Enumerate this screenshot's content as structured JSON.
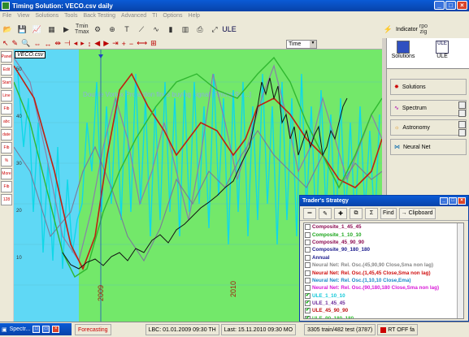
{
  "window": {
    "title": "Timing Solution:  VECO.csv  daily"
  },
  "menu": [
    "File",
    "View",
    "Solutions",
    "Tools",
    "Back Testing",
    "Advanced",
    "TI",
    "Options",
    "Help"
  ],
  "toolbar": {
    "tmin": "Tmin",
    "tmax": "Tmax",
    "zoom_select": "Time",
    "indicator": "Indicator",
    "rpo": "rpo",
    "zig": "zig"
  },
  "top_right": {
    "solutions": "Solutions",
    "ule": "ULE"
  },
  "chart": {
    "file_label": "VECO.csv",
    "watermark": "Double Vortex Projection finds buying signal [Timing Sol...]",
    "year_2009": "2009",
    "year_2010": "2010",
    "y_labels": [
      "50",
      "40",
      "30",
      "20",
      "10"
    ],
    "colors": {
      "bg_left": "#5fd8f5",
      "bg_right": "#73e86a"
    }
  },
  "left_tools": [
    "Panel",
    "Edit",
    "Start",
    "Line",
    "Fib",
    "abc",
    "date",
    "Fib",
    "%",
    "More",
    "Fib",
    "128"
  ],
  "right_panel": {
    "solutions_btn": "Solutions",
    "spectrum_btn": "Spectrum",
    "astronomy_btn": "Astronomy",
    "neural_btn": "Neural Net"
  },
  "strategy": {
    "title": "Trader's Strategy",
    "find": "Find",
    "clipboard": "Clipboard",
    "items": [
      {
        "label": "Composite_1_45_45",
        "color": "#8b0a50",
        "checked": false
      },
      {
        "label": "Composite_1_10_10",
        "color": "#1aa51a",
        "checked": false
      },
      {
        "label": "Composite_45_90_90",
        "color": "#8b0a50",
        "checked": false
      },
      {
        "label": "Composite_90_180_180",
        "color": "#1a1a8c",
        "checked": false
      },
      {
        "label": "Annual",
        "color": "#1a1a8c",
        "checked": false
      },
      {
        "label": "Neural Net: Rel. Osc.(45,90,90 Close,Sma non lag)",
        "color": "#888888",
        "checked": false
      },
      {
        "label": "Neural Net: Rel. Osc.(1,45,45 Close,Sma non lag)",
        "color": "#d01010",
        "checked": false
      },
      {
        "label": "Neural Net: Rel. Osc.(1,10,10 Close,Ema)",
        "color": "#1a8ac8",
        "checked": false
      },
      {
        "label": "Neural Net: Rel. Osc.(90,180,180 Close,Sma non lag)",
        "color": "#d81ad8",
        "checked": false
      },
      {
        "label": "ULE_1_10_10",
        "color": "#10c8d8",
        "checked": true
      },
      {
        "label": "ULE_1_45_45",
        "color": "#6b2a9a",
        "checked": true
      },
      {
        "label": "ULE_45_90_90",
        "color": "#c01010",
        "checked": true
      },
      {
        "label": "ULE_90_180_180",
        "color": "#30c030",
        "checked": true
      }
    ]
  },
  "status": {
    "spectr": "Spectr...",
    "forecasting": "Forecasting",
    "lbc": "LBC: 01.01.2009  09:30 TH",
    "last": "Last:  15.11.2010  09:30 MO",
    "train": "3305 train/482 test (3787)",
    "rt": "RT OFF fa"
  }
}
